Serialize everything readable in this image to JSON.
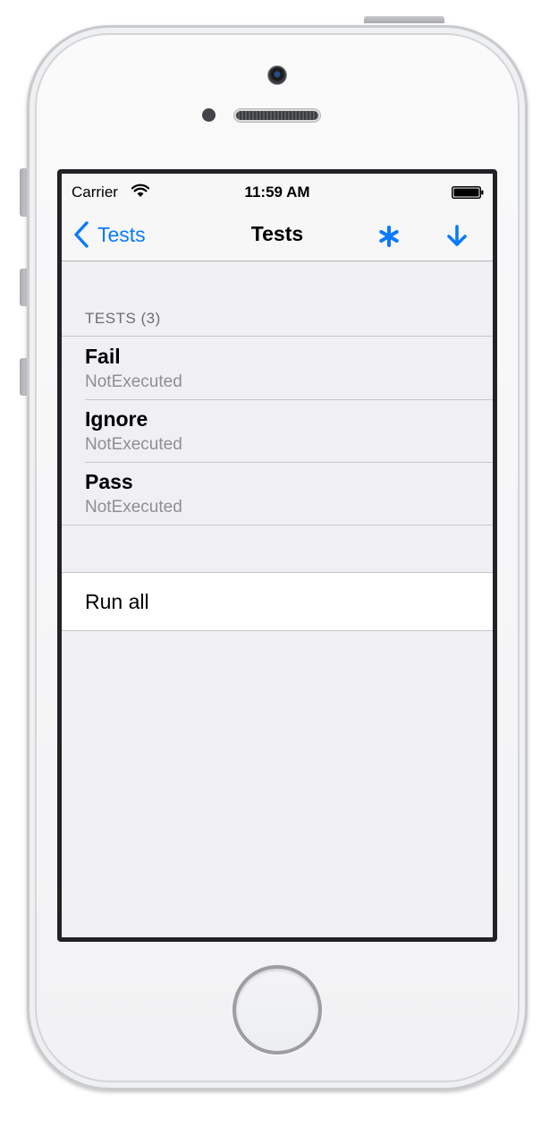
{
  "status_bar": {
    "carrier": "Carrier",
    "time": "11:59 AM"
  },
  "nav": {
    "back_label": "Tests",
    "title": "Tests",
    "accent_color": "#0a7aff",
    "right_icons": [
      "asterisk-icon",
      "download-arrow-icon"
    ]
  },
  "tests_section": {
    "header": "TESTS (3)",
    "items": [
      {
        "name": "Fail",
        "status": "NotExecuted"
      },
      {
        "name": "Ignore",
        "status": "NotExecuted"
      },
      {
        "name": "Pass",
        "status": "NotExecuted"
      }
    ]
  },
  "actions": {
    "run_all_label": "Run all"
  }
}
